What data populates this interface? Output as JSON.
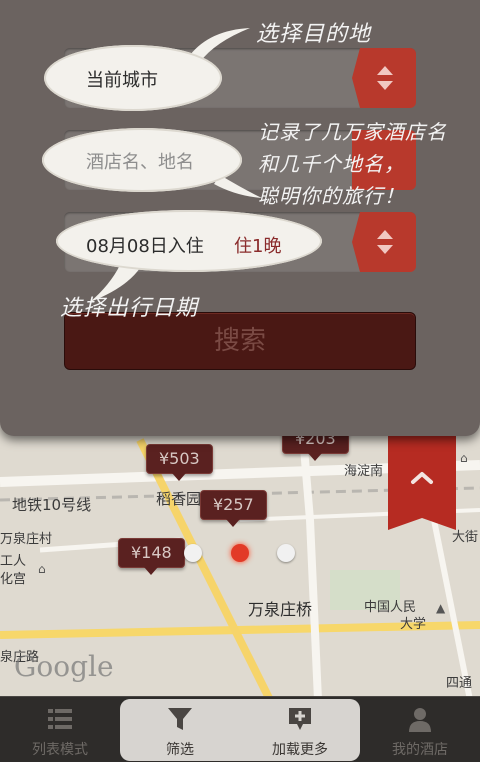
{
  "search_form": {
    "city_value": "当前城市",
    "keyword_placeholder": "酒店名、地名",
    "checkin_text": "08月08日入住",
    "nights_text": "住1晚",
    "search_label": "搜索"
  },
  "annotations": {
    "choose_destination": "选择目的地",
    "records_line1": "记录了几万家酒店名",
    "records_line2": "和几千个地名，",
    "records_line3": "聪明你的旅行！",
    "choose_date": "选择出行日期"
  },
  "map": {
    "labels": {
      "line10": "地铁10号线",
      "daoxiang": "稻香园",
      "wanquanzhuang_village": "万泉庄村",
      "gongren": "工人",
      "culture": "化宫",
      "wanquanzhuang_bridge": "万泉庄桥",
      "renmin": "中国人民",
      "daxue": "大学",
      "quanzhuang_road": "泉庄路",
      "haidian_south": "海淀南",
      "dajie": "大街",
      "sitong": "四通"
    },
    "price_pins": [
      "¥503",
      "¥257",
      "¥148",
      "¥203"
    ],
    "google": "Google",
    "page_count": 3,
    "active_page": 2
  },
  "tabbar": {
    "tabs": [
      {
        "label": "列表模式",
        "icon": "list-icon"
      },
      {
        "label": "筛选",
        "icon": "filter-icon"
      },
      {
        "label": "加载更多",
        "icon": "load-more-icon"
      },
      {
        "label": "我的酒店",
        "icon": "user-icon"
      }
    ]
  },
  "colors": {
    "accent_red": "#b8392c",
    "panel_bg": "#6b6360",
    "pin_bg": "#5a2120"
  }
}
